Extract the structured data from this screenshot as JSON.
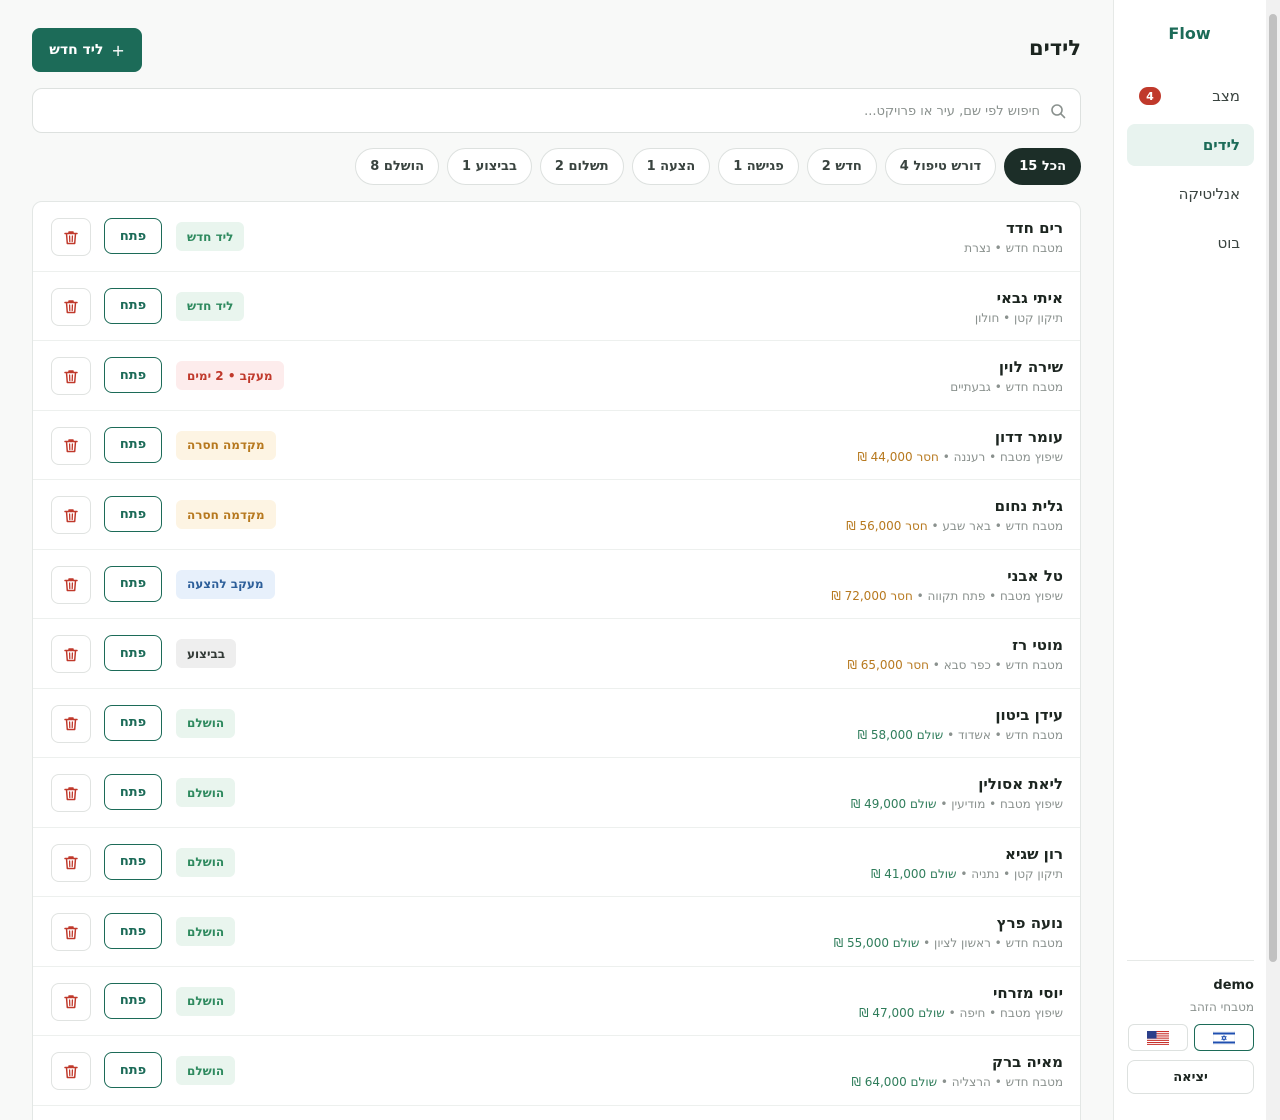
{
  "sidebar": {
    "brand": "Flow",
    "nav": [
      {
        "label": "מצב",
        "badge": "4"
      },
      {
        "label": "לידים"
      },
      {
        "label": "אנליטיקה"
      },
      {
        "label": "בוט"
      }
    ],
    "user_name": "demo",
    "business": "מטבחי הזהב",
    "logout_label": "יציאה"
  },
  "header": {
    "title": "לידים",
    "new_lead_label": "ליד חדש",
    "new_lead_icon": "plus-icon"
  },
  "search": {
    "placeholder": "חיפוש לפי שם, עיר או פרויקט...",
    "value": ""
  },
  "filters": [
    {
      "label": "הכל 15",
      "active": true
    },
    {
      "label": "דורש טיפול 4"
    },
    {
      "label": "חדש 2"
    },
    {
      "label": "פגישה 1"
    },
    {
      "label": "הצעה 1"
    },
    {
      "label": "תשלום 2"
    },
    {
      "label": "בביצוע 1"
    },
    {
      "label": "הושלם 8"
    }
  ],
  "leads": [
    {
      "name": "רים חדד",
      "sub": "מטבח חדש • נצרת",
      "amount": "",
      "status": "ליד חדש",
      "status_type": "new"
    },
    {
      "name": "איתי גבאי",
      "sub": "תיקון קטן • חולון",
      "amount": "",
      "status": "ליד חדש",
      "status_type": "new"
    },
    {
      "name": "שירה לוין",
      "sub": "מטבח חדש • גבעתיים",
      "amount": "",
      "status": "מעקב • 2 ימים",
      "status_type": "followup"
    },
    {
      "name": "עומר דדון",
      "sub": "שיפוץ מטבח • רעננה • ",
      "amount": "חסר 44,000 ₪",
      "status": "מקדמה חסרה",
      "status_type": "deposit"
    },
    {
      "name": "גלית נחום",
      "sub": "מטבח חדש • באר שבע • ",
      "amount": "חסר 56,000 ₪",
      "status": "מקדמה חסרה",
      "status_type": "deposit"
    },
    {
      "name": "טל אבני",
      "sub": "שיפוץ מטבח • פתח תקווה • ",
      "amount": "חסר 72,000 ₪",
      "status": "מעקב להצעה",
      "status_type": "proposal"
    },
    {
      "name": "מוטי רז",
      "sub": "מטבח חדש • כפר סבא • ",
      "amount": "חסר 65,000 ₪",
      "status": "בביצוע",
      "status_type": "exec"
    },
    {
      "name": "עידן ביטון",
      "sub": "מטבח חדש • אשדוד • ",
      "amount": "שולם 58,000 ₪",
      "status": "הושלם",
      "status_type": "done"
    },
    {
      "name": "ליאת אסולין",
      "sub": "שיפוץ מטבח • מודיעין • ",
      "amount": "שולם 49,000 ₪",
      "status": "הושלם",
      "status_type": "done"
    },
    {
      "name": "רון שגיא",
      "sub": "תיקון קטן • נתניה • ",
      "amount": "שולם 41,000 ₪",
      "status": "הושלם",
      "status_type": "done"
    },
    {
      "name": "נועה פרץ",
      "sub": "מטבח חדש • ראשון לציון • ",
      "amount": "שולם 55,000 ₪",
      "status": "הושלם",
      "status_type": "done"
    },
    {
      "name": "יוסי מזרחי",
      "sub": "שיפוץ מטבח • חיפה • ",
      "amount": "שולם 47,000 ₪",
      "status": "הושלם",
      "status_type": "done"
    },
    {
      "name": "מאיה ברק",
      "sub": "מטבח חדש • הרצליה • ",
      "amount": "שולם 64,000 ₪",
      "status": "הושלם",
      "status_type": "done"
    }
  ],
  "row_actions": {
    "open_label": "פתח",
    "delete_icon": "trash-icon"
  },
  "colors": {
    "brand": "#1c6b58",
    "danger": "#c0392b",
    "owed": "#b7791f",
    "paid": "#2f7d5b"
  }
}
